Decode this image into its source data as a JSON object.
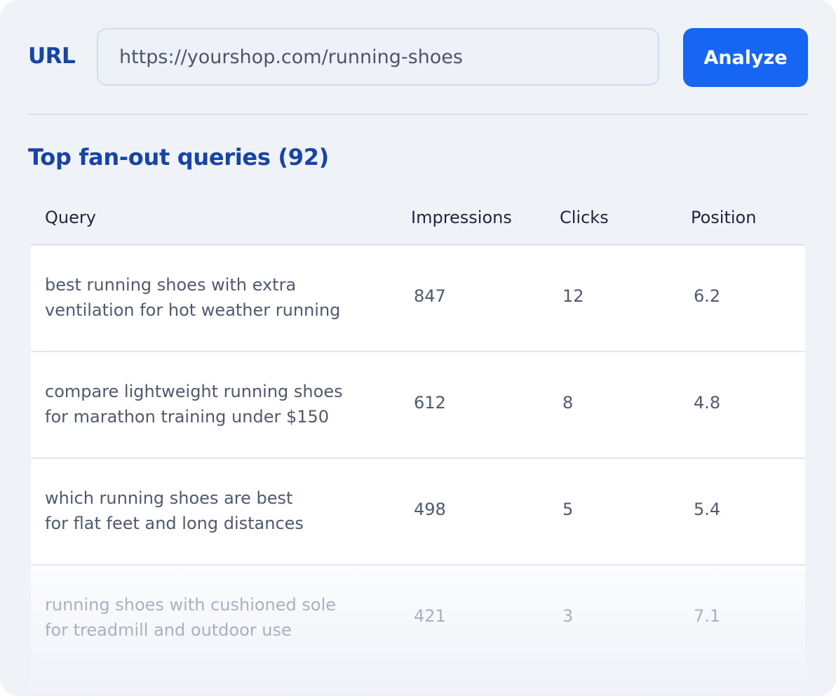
{
  "form": {
    "url_label": "URL",
    "url_value": "https://yourshop.com/running-shoes",
    "analyze_label": "Analyze"
  },
  "section": {
    "title": "Top fan-out queries (92)"
  },
  "table": {
    "columns": [
      "Query",
      "Impressions",
      "Clicks",
      "Position"
    ],
    "rows": [
      {
        "query_line1": "best running shoes with extra",
        "query_line2": "ventilation for hot weather running",
        "impressions": "847",
        "clicks": "12",
        "position": "6.2"
      },
      {
        "query_line1": "compare lightweight running shoes",
        "query_line2": "for marathon training under $150",
        "impressions": "612",
        "clicks": "8",
        "position": "4.8"
      },
      {
        "query_line1": "which running shoes are best",
        "query_line2": "for flat feet and long distances",
        "impressions": "498",
        "clicks": "5",
        "position": "5.4"
      },
      {
        "query_line1": "running shoes with cushioned sole",
        "query_line2": "for treadmill and outdoor use",
        "impressions": "421",
        "clicks": "3",
        "position": "7.1"
      }
    ]
  },
  "colors": {
    "accent": "#1766f3",
    "heading": "#1745a7",
    "background": "#eff2f7"
  }
}
